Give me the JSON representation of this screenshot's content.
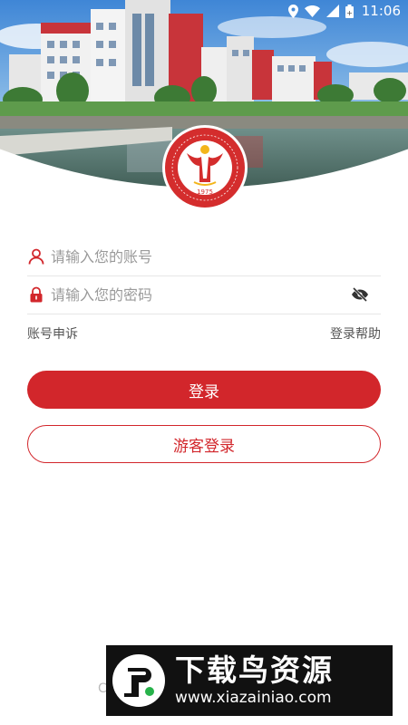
{
  "status_bar": {
    "time": "11:06",
    "icons": [
      "location-icon",
      "wifi-icon",
      "signal-icon",
      "battery-icon"
    ]
  },
  "header": {
    "image": "campus-photo",
    "emblem_year": "1975"
  },
  "login_form": {
    "account_placeholder": "请输入您的账号",
    "account_value": "",
    "password_placeholder": "请输入您的密码",
    "password_value": "",
    "account_icon": "user-icon",
    "password_icon": "lock-icon",
    "visibility_icon": "eye-off-icon",
    "account_appeal": "账号申诉",
    "login_help": "登录帮助",
    "login_button": "登录",
    "guest_login_button": "游客登录"
  },
  "watermark": {
    "title": "下载鸟资源",
    "url": "www.xiazainiao.com",
    "partial_text": "C"
  },
  "colors": {
    "primary": "#d2262b",
    "text_placeholder": "#9a9a9a",
    "text_secondary": "#555555",
    "divider": "#e6e6e6"
  }
}
